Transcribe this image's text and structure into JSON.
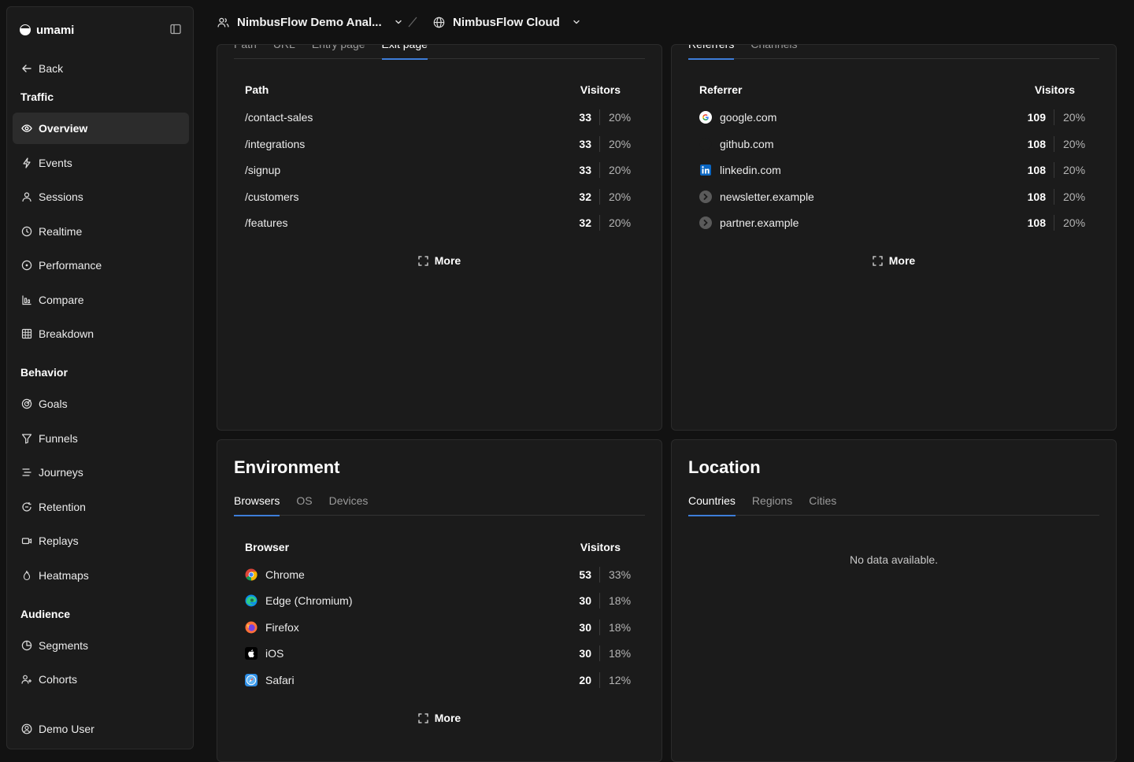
{
  "app": {
    "name": "umami",
    "back_label": "Back",
    "user_label": "Demo User"
  },
  "sidebar": {
    "sections": [
      {
        "label": "Traffic",
        "items": [
          {
            "label": "Overview",
            "icon": "eye-icon",
            "active": true
          },
          {
            "label": "Events",
            "icon": "bolt-icon"
          },
          {
            "label": "Sessions",
            "icon": "user-icon"
          },
          {
            "label": "Realtime",
            "icon": "clock-icon"
          },
          {
            "label": "Performance",
            "icon": "gauge-icon"
          },
          {
            "label": "Compare",
            "icon": "bar-chart-icon"
          },
          {
            "label": "Breakdown",
            "icon": "grid-icon"
          }
        ]
      },
      {
        "label": "Behavior",
        "items": [
          {
            "label": "Goals",
            "icon": "target-icon"
          },
          {
            "label": "Funnels",
            "icon": "funnel-icon"
          },
          {
            "label": "Journeys",
            "icon": "route-icon"
          },
          {
            "label": "Retention",
            "icon": "retention-icon"
          },
          {
            "label": "Replays",
            "icon": "video-icon"
          },
          {
            "label": "Heatmaps",
            "icon": "flame-icon"
          }
        ]
      },
      {
        "label": "Audience",
        "items": [
          {
            "label": "Segments",
            "icon": "pie-icon"
          },
          {
            "label": "Cohorts",
            "icon": "users-icon"
          }
        ]
      }
    ]
  },
  "topbar": {
    "team": "NimbusFlow Demo Anal...",
    "website": "NimbusFlow Cloud"
  },
  "pages_card": {
    "tabs": [
      "Path",
      "URL",
      "Entry page",
      "Exit page"
    ],
    "active_tab": 3,
    "col_label": "Path",
    "col_value": "Visitors",
    "rows": [
      {
        "label": "/contact-sales",
        "value": "33",
        "pct": "20%"
      },
      {
        "label": "/integrations",
        "value": "33",
        "pct": "20%"
      },
      {
        "label": "/signup",
        "value": "33",
        "pct": "20%"
      },
      {
        "label": "/customers",
        "value": "32",
        "pct": "20%"
      },
      {
        "label": "/features",
        "value": "32",
        "pct": "20%"
      }
    ],
    "more_label": "More"
  },
  "sources_card": {
    "tabs": [
      "Referrers",
      "Channels"
    ],
    "active_tab": 0,
    "col_label": "Referrer",
    "col_value": "Visitors",
    "rows": [
      {
        "label": "google.com",
        "value": "109",
        "pct": "20%",
        "icon": "google-icon"
      },
      {
        "label": "github.com",
        "value": "108",
        "pct": "20%",
        "icon": "github-icon"
      },
      {
        "label": "linkedin.com",
        "value": "108",
        "pct": "20%",
        "icon": "linkedin-icon"
      },
      {
        "label": "newsletter.example",
        "value": "108",
        "pct": "20%",
        "icon": "globe-icon"
      },
      {
        "label": "partner.example",
        "value": "108",
        "pct": "20%",
        "icon": "globe-icon"
      }
    ],
    "more_label": "More"
  },
  "environment_card": {
    "title": "Environment",
    "tabs": [
      "Browsers",
      "OS",
      "Devices"
    ],
    "active_tab": 0,
    "col_label": "Browser",
    "col_value": "Visitors",
    "rows": [
      {
        "label": "Chrome",
        "value": "53",
        "pct": "33%",
        "icon": "chrome-icon"
      },
      {
        "label": "Edge (Chromium)",
        "value": "30",
        "pct": "18%",
        "icon": "edge-icon"
      },
      {
        "label": "Firefox",
        "value": "30",
        "pct": "18%",
        "icon": "firefox-icon"
      },
      {
        "label": "iOS",
        "value": "30",
        "pct": "18%",
        "icon": "apple-icon"
      },
      {
        "label": "Safari",
        "value": "20",
        "pct": "12%",
        "icon": "safari-icon"
      }
    ],
    "more_label": "More"
  },
  "location_card": {
    "title": "Location",
    "tabs": [
      "Countries",
      "Regions",
      "Cities"
    ],
    "active_tab": 0,
    "empty_text": "No data available."
  },
  "colors": {
    "accent": "#3d7dd8",
    "background": "#121212",
    "panel": "#1b1b1b"
  }
}
